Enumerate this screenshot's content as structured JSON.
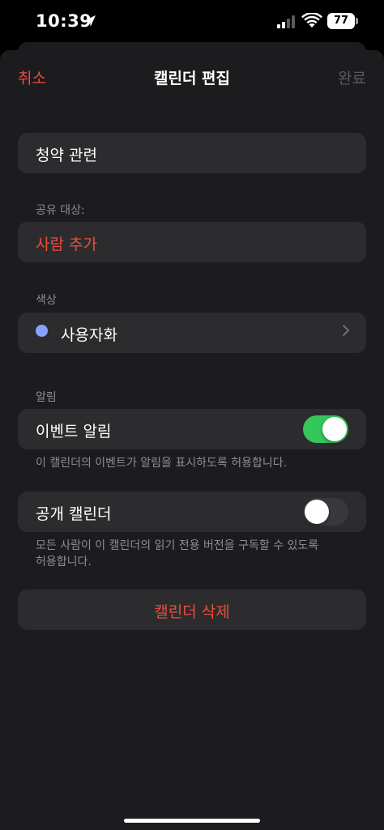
{
  "status_bar": {
    "time": "10:39",
    "battery": "77"
  },
  "nav": {
    "cancel_label": "취소",
    "title": "캘린더 편집",
    "done_label": "완료"
  },
  "calendar_name": {
    "value": "청약 관련"
  },
  "sharing": {
    "section_label": "공유 대상:",
    "add_person_label": "사람 추가"
  },
  "color": {
    "section_label": "색상",
    "selected_name": "사용자화",
    "swatch": "#83a5ff"
  },
  "alerts": {
    "section_label": "알림",
    "event_alerts_label": "이벤트 알림",
    "event_alerts_on": true,
    "event_alerts_note": "이 캘린더의 이벤트가 알림을 표시하도록 허용합니다."
  },
  "public_calendar": {
    "label": "공개 캘린더",
    "on": false,
    "note": "모든 사람이 이 캘린더의 읽기 전용 버전을 구독할 수 있도록 허용합니다."
  },
  "delete": {
    "label": "캘린더 삭제"
  },
  "colors": {
    "accent_red": "#eb4d3d",
    "toggle_green": "#34c759",
    "sheet_bg": "#1c1c1e",
    "cell_bg": "#2c2c2e"
  }
}
